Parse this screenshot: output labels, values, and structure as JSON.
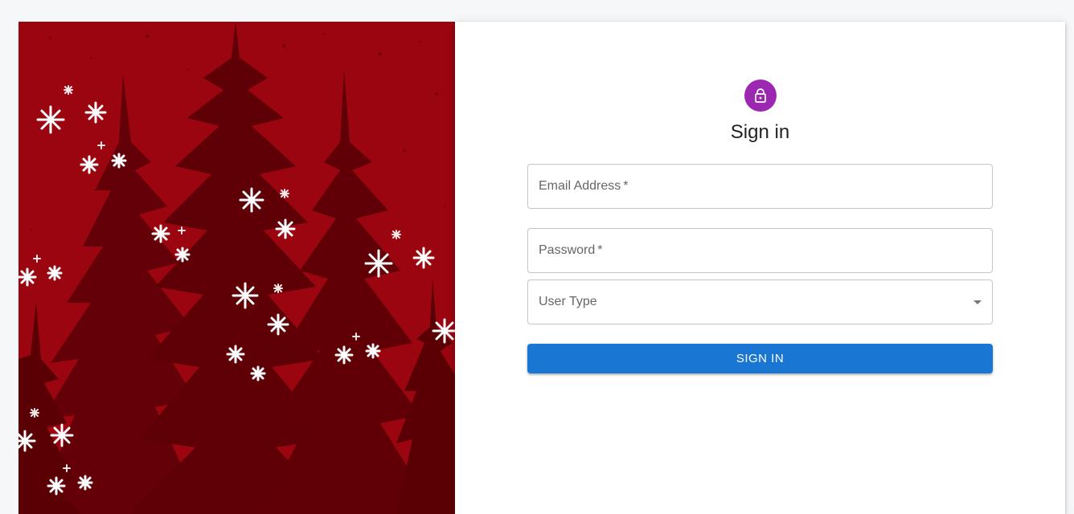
{
  "hero": {
    "image": "winter-forest-snowflakes-illustration",
    "colors": {
      "sky": "#9a0510",
      "trees": "#600006",
      "snow": "#ffffff"
    }
  },
  "signin": {
    "icon": "lock-icon",
    "title": "Sign in",
    "email_label": "Email Address",
    "password_label": "Password",
    "required_mark": "*",
    "user_type_label": "User Type",
    "submit_label": "SIGN IN"
  },
  "colors": {
    "avatar": "#9c27b0",
    "primary": "#1976d2"
  }
}
